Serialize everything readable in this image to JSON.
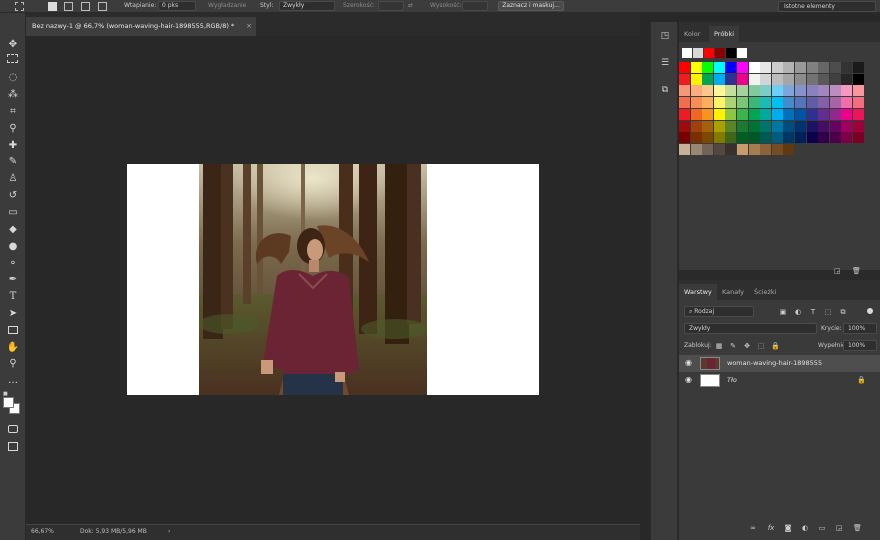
{
  "options_bar": {
    "feather_label": "Wtapianie:",
    "feather_value": "0 pks",
    "antialias_label": "Wygładzanie",
    "style_label": "Styl:",
    "style_value": "Zwykły",
    "width_label": "Szerokość:",
    "height_label": "Wysokość:",
    "select_mask_label": "Zaznacz i maskuj...",
    "workspace_label": "Istotne elementy"
  },
  "document": {
    "tab_title": "Bez nazwy-1 @ 66,7% (woman-waving-hair-1898555,RGB/8) *",
    "close_glyph": "×"
  },
  "status": {
    "zoom": "66,67%",
    "doc_size": "Dok: 5,93 MB/5,96 MB",
    "arrow": "›"
  },
  "color_panel": {
    "tabs": [
      "Kolor",
      "Próbki"
    ],
    "active_tab": "Próbki",
    "recent_swatches": [
      "#ffffff",
      "#d9d9d9",
      "#ff0000",
      "#8b0000",
      "#000000",
      "#ffffff"
    ],
    "swatch_rows": [
      [
        "#ff0000",
        "#ffff00",
        "#00ff00",
        "#00ffff",
        "#0000ff",
        "#ff00ff",
        "#ffffff",
        "#e6e6e6",
        "#cccccc",
        "#b3b3b3",
        "#999999",
        "#808080",
        "#666666",
        "#4d4d4d",
        "#333333",
        "#1a1a1a"
      ],
      [
        "#ed1c24",
        "#fff200",
        "#00a651",
        "#00aeef",
        "#2e3192",
        "#ec008c",
        "#f2f2f2",
        "#d4d4d4",
        "#bdbdbd",
        "#a6a6a6",
        "#8c8c8c",
        "#737373",
        "#595959",
        "#404040",
        "#262626",
        "#000000"
      ],
      [
        "#f7977a",
        "#f9ad81",
        "#fdc68a",
        "#fff79a",
        "#c4df9b",
        "#a2d39c",
        "#82ca9d",
        "#7bcdc8",
        "#6ecff6",
        "#7ea7d8",
        "#8493ca",
        "#8882be",
        "#a187be",
        "#bc8dbf",
        "#f49ac2",
        "#f6989d"
      ],
      [
        "#f26c4f",
        "#f68e55",
        "#fbaf5c",
        "#fff467",
        "#acd372",
        "#7cc576",
        "#3bb878",
        "#1abbb4",
        "#00bff3",
        "#438ccb",
        "#5574b9",
        "#605ca8",
        "#855fa8",
        "#a763a8",
        "#f06ea9",
        "#f26d7d"
      ],
      [
        "#ed1c24",
        "#f26522",
        "#f7941d",
        "#fff200",
        "#8dc73f",
        "#39b54a",
        "#00a651",
        "#00a99d",
        "#00aeef",
        "#0072bc",
        "#0054a6",
        "#2e3192",
        "#662d91",
        "#92278f",
        "#ec008c",
        "#ed145b"
      ],
      [
        "#9e0b0f",
        "#a0410d",
        "#a36209",
        "#aba000",
        "#598527",
        "#1a7b30",
        "#007236",
        "#00746b",
        "#0076a3",
        "#004b80",
        "#003471",
        "#1b1464",
        "#440e62",
        "#630460",
        "#9e005d",
        "#9e0039"
      ],
      [
        "#790000",
        "#7b2e00",
        "#7d4900",
        "#827b00",
        "#406618",
        "#005e20",
        "#005826",
        "#005952",
        "#005b7f",
        "#003663",
        "#002157",
        "#0d004c",
        "#32004b",
        "#4b0049",
        "#7b0046",
        "#7a0026"
      ],
      [
        "#c7b299",
        "#998675",
        "#736357",
        "#534741",
        "#37302d",
        "#c69c6d",
        "#a67c52",
        "#8c6239",
        "#754c24",
        "#603913"
      ]
    ]
  },
  "layers_panel": {
    "tabs": [
      "Warstwy",
      "Kanały",
      "Ścieżki"
    ],
    "active_tab": "Warstwy",
    "filter_value": "Rodzaj",
    "blend_mode": "Zwykły",
    "opacity_label": "Krycie:",
    "opacity_value": "100%",
    "lock_label": "Zablokuj:",
    "fill_label": "Wypełnienie:",
    "fill_value": "100%",
    "layers": [
      {
        "name": "woman-waving-hair-1898555",
        "visible": true,
        "selected": true
      },
      {
        "name": "Tło",
        "visible": true,
        "selected": false,
        "locked": true
      }
    ]
  }
}
